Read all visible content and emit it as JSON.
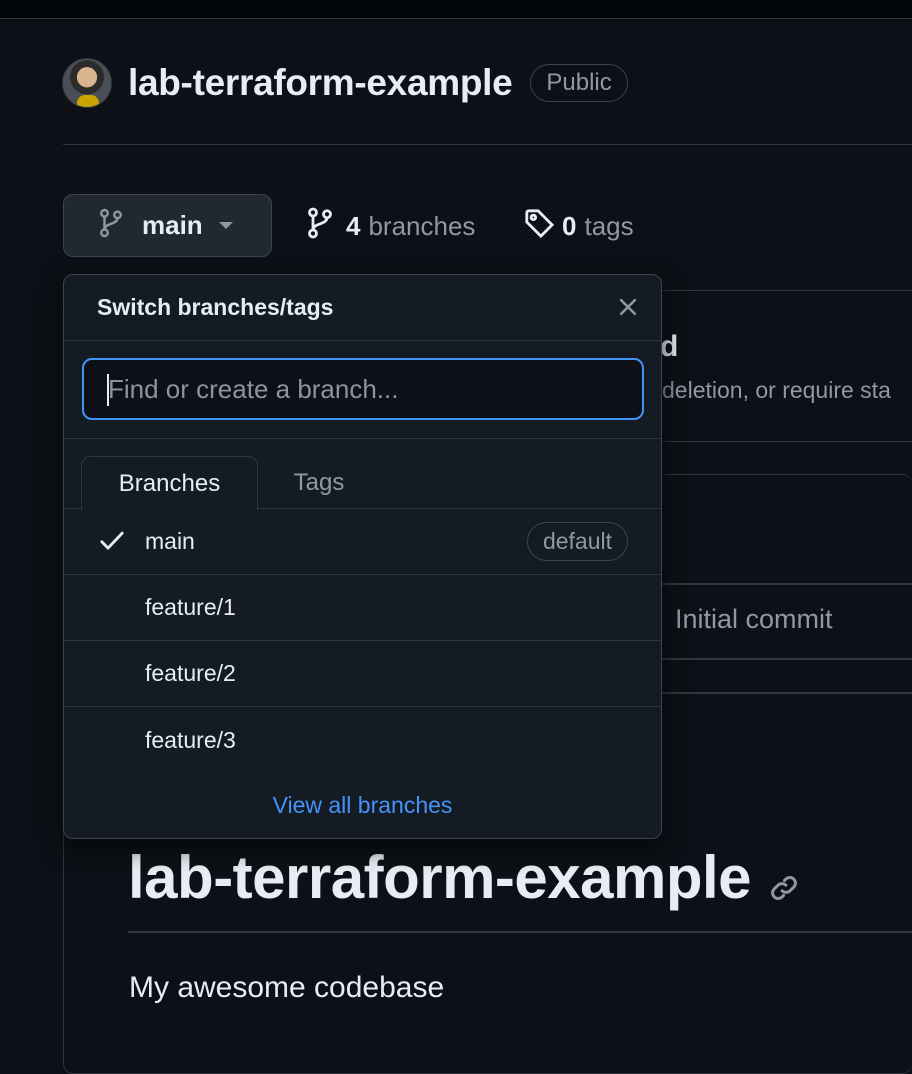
{
  "repo": {
    "name": "lab-terraform-example",
    "visibility": "Public"
  },
  "toolbar": {
    "current_branch": "main",
    "branches_count": "4",
    "branches_label": "branches",
    "tags_count": "0",
    "tags_label": "tags"
  },
  "dropdown": {
    "title": "Switch branches/tags",
    "filter_placeholder": "Find or create a branch...",
    "tabs": [
      {
        "label": "Branches",
        "active": true
      },
      {
        "label": "Tags",
        "active": false
      }
    ],
    "branches": [
      {
        "name": "main",
        "selected": true,
        "badge": "default"
      },
      {
        "name": "feature/1",
        "selected": false
      },
      {
        "name": "feature/2",
        "selected": false
      },
      {
        "name": "feature/3",
        "selected": false
      }
    ],
    "view_all_label": "View all branches"
  },
  "background": {
    "protection_title_fragment": "d",
    "protection_desc_fragment": "deletion, or require sta",
    "commit_message": "Initial commit"
  },
  "readme": {
    "title": "lab-terraform-example",
    "body": "My awesome codebase"
  },
  "colors": {
    "background": "#0d1117",
    "accent": "#4493f8",
    "border": "#30363d",
    "muted": "#9198a1"
  }
}
